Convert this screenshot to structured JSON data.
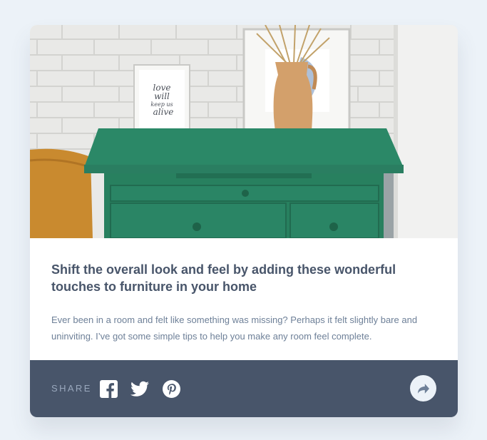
{
  "article": {
    "image_alt": "Green wooden dresser with framed prints and a vase against a white brick wall",
    "frame_text": "love will keep us alive",
    "title": "Shift the overall look and feel by adding these wonderful touches to furniture in your home",
    "description": "Ever been in a room and felt like something was missing? Perhaps it felt slightly bare and uninviting. I’ve got some simple tips to help you make any room feel complete."
  },
  "footer": {
    "share_label": "SHARE",
    "social_icons": [
      "facebook-icon",
      "twitter-icon",
      "pinterest-icon"
    ],
    "share_icon": "share-arrow-icon"
  },
  "colors": {
    "background": "#ecf2f8",
    "card": "#ffffff",
    "title": "#48556a",
    "text": "#6e8098",
    "footer": "#48556a",
    "share_label": "#9aa8bd",
    "share_button": "#ecf2f8"
  }
}
